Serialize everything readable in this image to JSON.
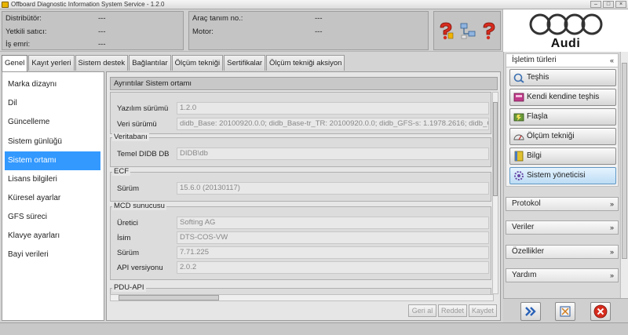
{
  "window": {
    "title": "Offboard Diagnostic Information System Service - 1.2.0"
  },
  "vehicle_info": {
    "left": [
      {
        "label": "Distribütör:",
        "value": "---"
      },
      {
        "label": "Yetkili satıcı:",
        "value": "---"
      },
      {
        "label": "İş emri:",
        "value": "---"
      }
    ],
    "right": [
      {
        "label": "Araç tanım no.:",
        "value": "---"
      },
      {
        "label": "Motor:",
        "value": "---"
      }
    ]
  },
  "header_icons": [
    "help-question-icon",
    "network-connection-icon",
    "help-info-icon"
  ],
  "brand": {
    "name": "Audi"
  },
  "tabs": [
    {
      "label": "Genel",
      "active": true
    },
    {
      "label": "Kayıt yerleri"
    },
    {
      "label": "Sistem destek"
    },
    {
      "label": "Bağlantılar"
    },
    {
      "label": "Ölçüm tekniği"
    },
    {
      "label": "Sertifikalar"
    },
    {
      "label": "Ölçüm tekniği aksiyon"
    }
  ],
  "nav": [
    {
      "label": "Marka dizaynı"
    },
    {
      "label": "Dil"
    },
    {
      "label": "Güncelleme"
    },
    {
      "label": "Sistem günlüğü"
    },
    {
      "label": "Sistem ortamı",
      "selected": true
    },
    {
      "label": "Lisans bilgileri"
    },
    {
      "label": "Küresel ayarlar"
    },
    {
      "label": "GFS süreci"
    },
    {
      "label": "Klavye ayarları"
    },
    {
      "label": "Bayi verileri"
    }
  ],
  "panel": {
    "title": "Ayrıntılar Sistem ortamı",
    "software": [
      {
        "label": "Yazılım sürümü",
        "value": "1.2.0"
      },
      {
        "label": "Veri sürümü",
        "value": "didb_Base: 20100920.0.0; didb_Base-tr_TR: 20100920.0.0; didb_GFS-s: 1.1978.2616; didb_GFS"
      }
    ],
    "database": {
      "title": "Veritabanı",
      "fields": [
        {
          "label": "Temel DIDB DB",
          "value": "DIDB\\db"
        }
      ]
    },
    "ecf": {
      "title": "ECF",
      "fields": [
        {
          "label": "Sürüm",
          "value": "15.6.0 (20130117)"
        }
      ]
    },
    "mcd": {
      "title": "MCD sunucusu",
      "fields": [
        {
          "label": "Üretici",
          "value": "Softing AG"
        },
        {
          "label": "İsim",
          "value": "DTS-COS-VW"
        },
        {
          "label": "Sürüm",
          "value": "7.71.225"
        },
        {
          "label": "API versiyonu",
          "value": "2.0.2"
        }
      ]
    },
    "pdu": {
      "title": "PDU-API"
    },
    "actions": {
      "undo": "Geri al",
      "reject": "Reddet",
      "save": "Kaydet"
    }
  },
  "right_panel": {
    "operation_modes": {
      "title": "İşletim türleri",
      "items": [
        {
          "label": "Teşhis",
          "icon": "diagnosis-icon"
        },
        {
          "label": "Kendi kendine teşhis",
          "icon": "self-diagnosis-icon"
        },
        {
          "label": "Flaşla",
          "icon": "flash-icon"
        },
        {
          "label": "Ölçüm tekniği",
          "icon": "measurement-icon"
        },
        {
          "label": "Bilgi",
          "icon": "info-book-icon"
        },
        {
          "label": "Sistem yöneticisi",
          "icon": "system-admin-icon",
          "active": true
        }
      ]
    },
    "sections": [
      {
        "label": "Protokol"
      },
      {
        "label": "Veriler"
      },
      {
        "label": "Özellikler"
      },
      {
        "label": "Yardım"
      }
    ]
  },
  "bottom_buttons": [
    "forward-icon",
    "fit-screen-icon",
    "close-icon"
  ],
  "colors": {
    "selection": "#3399ff",
    "close_red": "#d62c1e"
  }
}
